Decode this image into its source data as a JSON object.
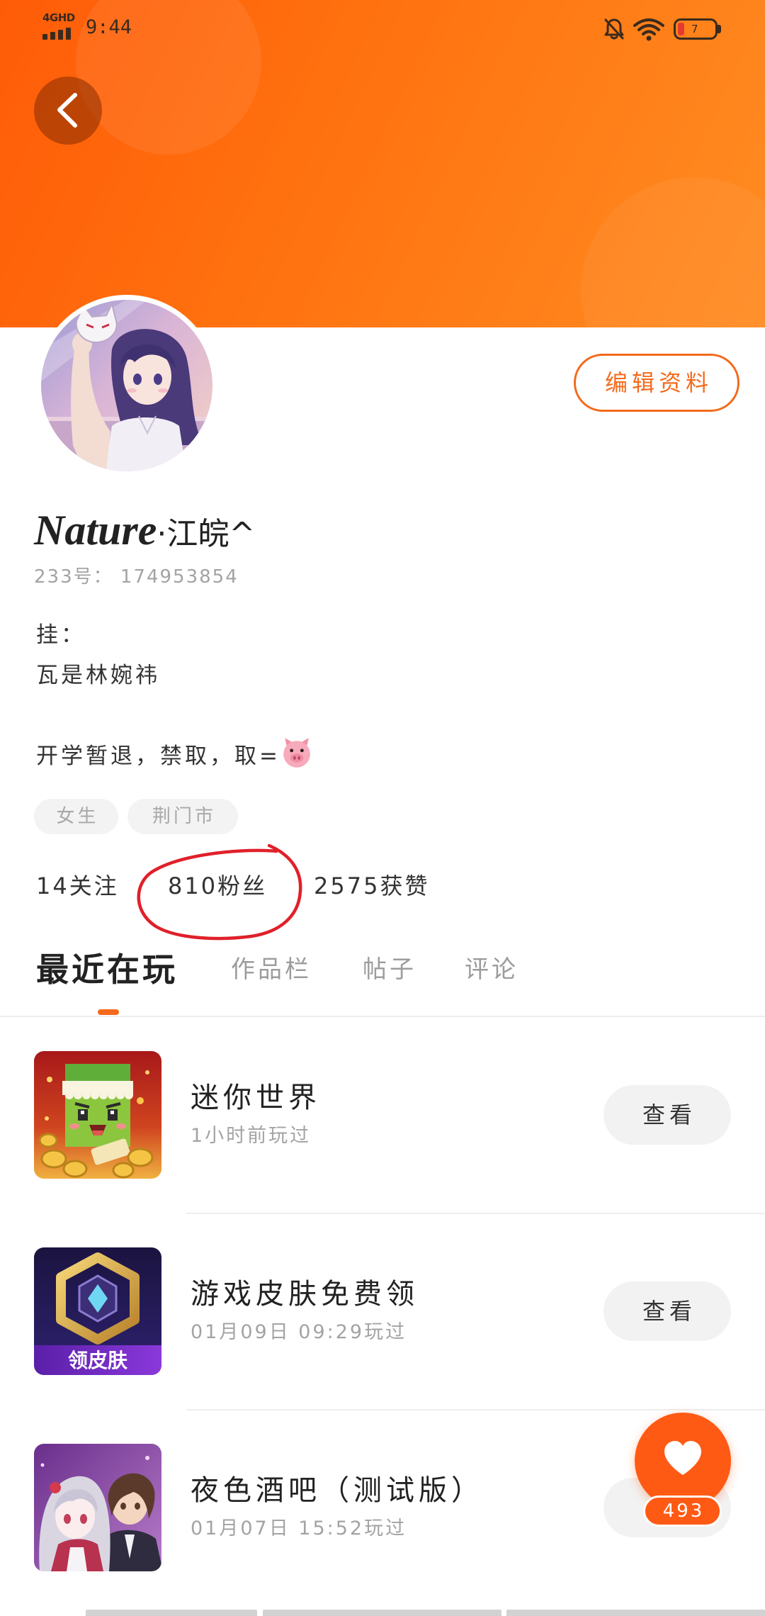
{
  "status_bar": {
    "network": "4GHD",
    "time": "9:44",
    "battery_level": "7",
    "icons": {
      "signal": "signal-bars-icon",
      "mute": "bell-slash-icon",
      "wifi": "wifi-icon",
      "battery": "battery-icon"
    }
  },
  "header": {
    "back_icon": "chevron-left-icon"
  },
  "profile": {
    "avatar": "anime-girl-avatar",
    "edit_label": "编辑资料",
    "name_latin": "Nature",
    "name_rest": "·江皖^",
    "id_line": "233号： 174953854",
    "bio": [
      "挂：",
      "瓦是林婉祎",
      "开学暂退，禁取，取="
    ],
    "bio_emoji_icon": "pig-face-emoji",
    "tags": [
      "女生",
      "荆门市"
    ]
  },
  "stats": [
    {
      "count": "14",
      "label": "关注"
    },
    {
      "count": "810",
      "label": "粉丝",
      "annotated": true
    },
    {
      "count": "2575",
      "label": "获赞"
    }
  ],
  "annotation": {
    "icon": "red-hand-drawn-circle",
    "color": "#E0202A"
  },
  "tabs": [
    {
      "label": "最近在玩",
      "active": true
    },
    {
      "label": "作品栏",
      "active": false
    },
    {
      "label": "帖子",
      "active": false
    },
    {
      "label": "评论",
      "active": false
    }
  ],
  "games": [
    {
      "name": "迷你世界",
      "played": "1小时前玩过",
      "action": "查看",
      "icon": "mini-world-game-icon"
    },
    {
      "name": "游戏皮肤免费领",
      "played": "01月09日 09:29玩过",
      "action": "查看",
      "icon": "free-skin-game-icon",
      "icon_text": "领皮肤"
    },
    {
      "name": "夜色酒吧（测试版）",
      "played": "01月07日 15:52玩过",
      "icon": "night-bar-game-icon"
    }
  ],
  "floating_like": {
    "icon": "heart-icon",
    "count": "493"
  },
  "colors": {
    "accent": "#F46A1C",
    "float": "#FF5A14",
    "header_start": "#FF5C08",
    "header_end": "#FF8C22",
    "annotation": "#E0202A",
    "text_primary": "#333333",
    "text_secondary": "#A3A3A3"
  }
}
